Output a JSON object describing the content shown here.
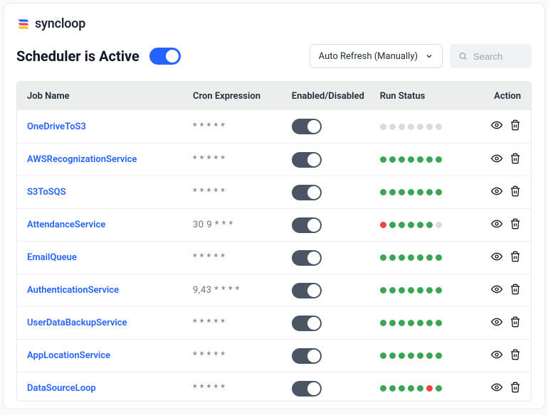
{
  "brand": {
    "name": "syncloop"
  },
  "header": {
    "title": "Scheduler is Active",
    "refresh_label": "Auto Refresh (Manually)",
    "search_placeholder": "Search"
  },
  "table": {
    "columns": {
      "job": "Job Name",
      "cron": "Cron Expression",
      "enabled": "Enabled/Disabled",
      "run": "Run Status",
      "action": "Action"
    }
  },
  "status_colors": {
    "grey": "#d9dbdf",
    "green": "#3aa655",
    "red": "#ef4444"
  },
  "jobs": [
    {
      "name": "OneDriveToS3",
      "cron": "* * * * *",
      "enabled": true,
      "runs": [
        "grey",
        "grey",
        "grey",
        "grey",
        "grey",
        "grey",
        "grey"
      ]
    },
    {
      "name": "AWSRecognizationService",
      "cron": "* * * * *",
      "enabled": true,
      "runs": [
        "green",
        "green",
        "green",
        "green",
        "green",
        "green",
        "green"
      ]
    },
    {
      "name": "S3ToSQS",
      "cron": "* * * * *",
      "enabled": true,
      "runs": [
        "green",
        "green",
        "green",
        "green",
        "green",
        "green",
        "green"
      ]
    },
    {
      "name": "AttendanceService",
      "cron": "30 9 * * *",
      "enabled": true,
      "runs": [
        "red",
        "green",
        "green",
        "green",
        "green",
        "green",
        "grey"
      ]
    },
    {
      "name": "EmailQueue",
      "cron": "* * * * *",
      "enabled": true,
      "runs": [
        "green",
        "green",
        "green",
        "green",
        "green",
        "green",
        "green"
      ]
    },
    {
      "name": "AuthenticationService",
      "cron": "9,43 * * * *",
      "enabled": true,
      "runs": [
        "green",
        "green",
        "green",
        "green",
        "green",
        "green",
        "green"
      ]
    },
    {
      "name": "UserDataBackupService",
      "cron": "* * * * *",
      "enabled": true,
      "runs": [
        "green",
        "green",
        "green",
        "green",
        "green",
        "green",
        "green"
      ]
    },
    {
      "name": "AppLocationService",
      "cron": "* * * * *",
      "enabled": true,
      "runs": [
        "green",
        "green",
        "green",
        "green",
        "green",
        "green",
        "green"
      ]
    },
    {
      "name": "DataSourceLoop",
      "cron": "* * * * *",
      "enabled": true,
      "runs": [
        "green",
        "green",
        "green",
        "green",
        "green",
        "red",
        "green"
      ]
    }
  ]
}
